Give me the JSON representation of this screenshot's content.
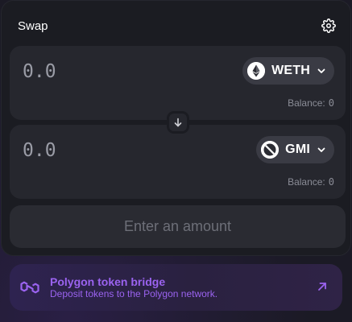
{
  "header": {
    "title": "Swap",
    "settings_icon": "gear-icon"
  },
  "input_panel": {
    "amount_placeholder": "0.0",
    "token_symbol": "WETH",
    "token_icon": "ethereum-icon",
    "balance_label": "Balance:",
    "balance_value": "0"
  },
  "switch": {
    "icon": "arrow-down-icon"
  },
  "output_panel": {
    "amount_placeholder": "0.0",
    "token_symbol": "GMI",
    "token_icon": "gmi-token-icon",
    "balance_label": "Balance:",
    "balance_value": "0"
  },
  "action_button": {
    "label": "Enter an amount"
  },
  "bridge_banner": {
    "title": "Polygon token bridge",
    "subtitle": "Deposit tokens to the Polygon network.",
    "logo_icon": "polygon-logo-icon",
    "arrow_icon": "external-arrow-icon",
    "accent_color": "#9b63f0"
  },
  "colors": {
    "background": "#1b1a25",
    "card": "#1b1c22",
    "panel": "#26272e",
    "token_pill": "#3a3b44",
    "muted_text": "#8a8c96"
  }
}
